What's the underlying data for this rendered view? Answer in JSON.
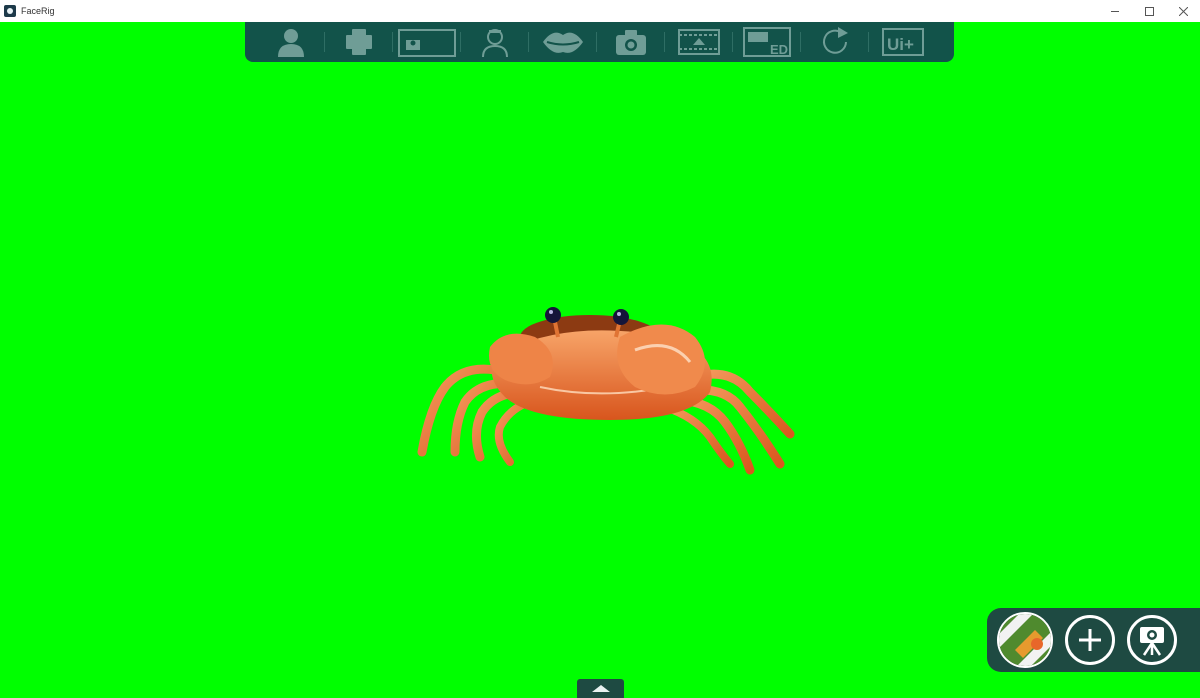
{
  "window": {
    "title": "FaceRig"
  },
  "toolbar": {
    "items": [
      {
        "name": "avatar-select",
        "icon": "person-icon"
      },
      {
        "name": "props",
        "icon": "cube-icon"
      },
      {
        "name": "background",
        "icon": "background-icon"
      },
      {
        "name": "tracking",
        "icon": "tracking-icon"
      },
      {
        "name": "lip-sync",
        "icon": "lips-icon"
      },
      {
        "name": "screenshot",
        "icon": "camera-icon"
      },
      {
        "name": "record-video",
        "icon": "film-icon"
      },
      {
        "name": "edit-mode",
        "icon": "ed-icon",
        "label": "ED"
      },
      {
        "name": "reset",
        "icon": "refresh-icon"
      },
      {
        "name": "advanced-ui",
        "icon": "ui-plus-icon",
        "label": "Ui+"
      }
    ]
  },
  "colors": {
    "background": "#00ff00",
    "toolbar": "#12534a",
    "dock": "#1e4a42"
  }
}
